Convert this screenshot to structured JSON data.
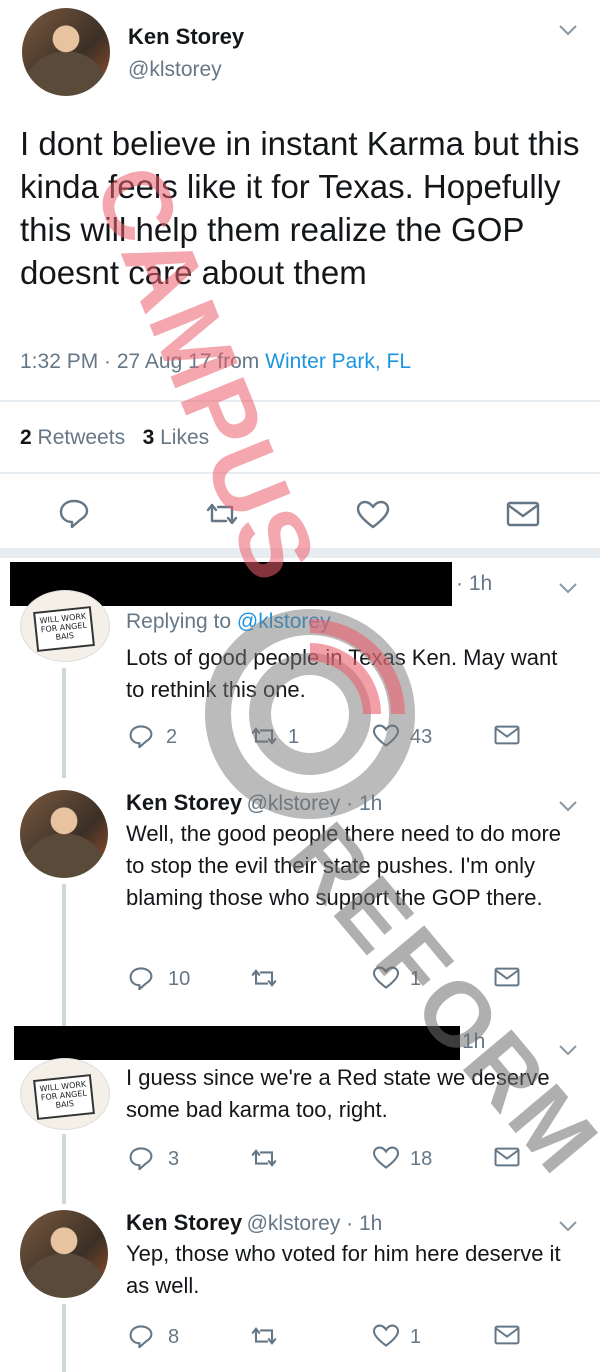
{
  "main_tweet": {
    "name": "Ken Storey",
    "handle": "@klstorey",
    "text": "I dont believe in instant Karma but this kinda feels like it for Texas. Hopefully this will help them realize the GOP doesnt care about them",
    "time": "1:32 PM · 27 Aug 17 from",
    "location": "Winter Park, FL",
    "retweets_count": "2",
    "retweets_label": "Retweets",
    "likes_count": "3",
    "likes_label": "Likes"
  },
  "replies": [
    {
      "name": "",
      "time": "· 1h",
      "replying_to_label": "Replying to",
      "replying_to": "@klstorey",
      "text": "Lots of good people in Texas Ken. May want to rethink this one.",
      "reply_count": "2",
      "retweet_count": "1",
      "like_count": "43",
      "avatar_sign": "WILL WORK FOR ANGEL BAIS"
    },
    {
      "name": "Ken Storey",
      "handle": "@klstorey · 1h",
      "text": "Well, the good people there need to do more to stop the evil their state pushes. I'm only blaming those who support the GOP there.",
      "reply_count": "10",
      "retweet_count": "",
      "like_count": "1"
    },
    {
      "name": "",
      "time": "1h",
      "text": "I guess since we're a Red state we deserve some bad karma too, right.",
      "reply_count": "3",
      "retweet_count": "",
      "like_count": "18",
      "avatar_sign": "WILL WORK FOR ANGEL BAIS"
    },
    {
      "name": "Ken Storey",
      "handle": "@klstorey · 1h",
      "text": "Yep, those who voted for him here deserve it as well.",
      "reply_count": "8",
      "retweet_count": "",
      "like_count": "1"
    }
  ],
  "watermark": {
    "line1": "CAMPUS",
    "line2": "REFORM"
  },
  "colors": {
    "link": "#1b95e0",
    "secondary_text": "#657786",
    "divider": "#e6ecf0"
  },
  "icons": [
    "chevron-down-icon",
    "reply-icon",
    "retweet-icon",
    "like-icon",
    "message-icon"
  ]
}
